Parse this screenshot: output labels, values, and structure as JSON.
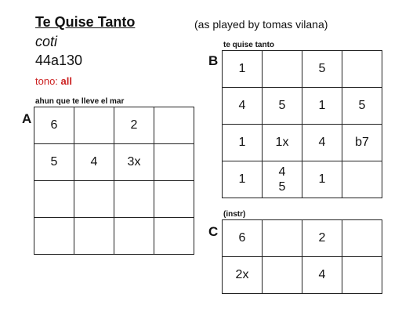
{
  "header": {
    "title": "Te Quise Tanto",
    "played_by": "(as played by tomas vilana)",
    "artist": "coti",
    "code": "44a130",
    "tono_label": "tono: ",
    "tono_value": "all"
  },
  "sections": {
    "A": {
      "letter": "A",
      "caption": "ahun que te lleve el mar",
      "rows": [
        [
          "6",
          "",
          "2",
          ""
        ],
        [
          "5",
          "4",
          "3x",
          ""
        ],
        [
          "",
          "",
          "",
          ""
        ],
        [
          "",
          "",
          "",
          ""
        ]
      ]
    },
    "B": {
      "letter": "B",
      "caption": "te quise tanto",
      "rows": [
        [
          "1",
          "",
          "5",
          ""
        ],
        [
          "4",
          "5",
          "1",
          "5"
        ],
        [
          "1",
          "1x",
          "4",
          "b7"
        ],
        [
          "1",
          [
            "4",
            "5"
          ],
          "1",
          ""
        ]
      ]
    },
    "C": {
      "letter": "C",
      "caption": "(instr)",
      "rows": [
        [
          "6",
          "",
          "2",
          ""
        ],
        [
          "2x",
          "",
          "4",
          ""
        ]
      ]
    }
  }
}
